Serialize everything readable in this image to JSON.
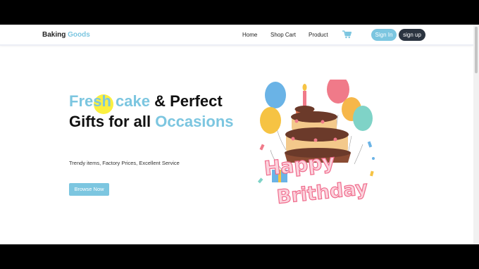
{
  "brand": {
    "name_part1": "Baking",
    "name_part2": "Goods"
  },
  "nav": {
    "links": [
      "Home",
      "Shop Cart",
      "Product"
    ],
    "cart_icon": "shopping-cart-icon",
    "signin_label": "Sign In",
    "signup_label": "sign up"
  },
  "hero": {
    "heading_accent_1": "Fresh cake",
    "heading_middle": " & Perfect Gifts for all ",
    "heading_accent_2": "Occasions",
    "subtitle": "Trendy items, Factory Prices, Excellent Service",
    "cta_label": "Browse Now",
    "image_text": "Happy Brithday"
  },
  "colors": {
    "accent": "#7cc6e0",
    "signup_bg": "#2b3440",
    "cake_pink": "#f06b8c",
    "chocolate": "#6b3a2a"
  }
}
